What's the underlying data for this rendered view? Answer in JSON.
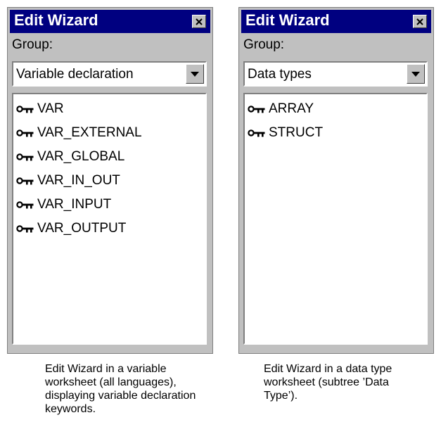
{
  "left_wizard": {
    "title": "Edit Wizard",
    "group_label": "Group:",
    "group_value": "Variable declaration",
    "items": [
      "VAR",
      "VAR_EXTERNAL",
      "VAR_GLOBAL",
      "VAR_IN_OUT",
      "VAR_INPUT",
      "VAR_OUTPUT"
    ],
    "caption": "Edit Wizard in a variable worksheet (all languages), displaying variable declaration keywords."
  },
  "right_wizard": {
    "title": "Edit Wizard",
    "group_label": "Group:",
    "group_value": "Data types",
    "items": [
      "ARRAY",
      "STRUCT"
    ],
    "caption": "Edit Wizard in a data type worksheet (subtree ’Data Type’)."
  },
  "icons": {
    "close": "close-icon",
    "dropdown": "dropdown-arrow-icon",
    "item": "key-icon"
  },
  "colors": {
    "titlebar": "#000080",
    "window": "#c0c0c0"
  }
}
